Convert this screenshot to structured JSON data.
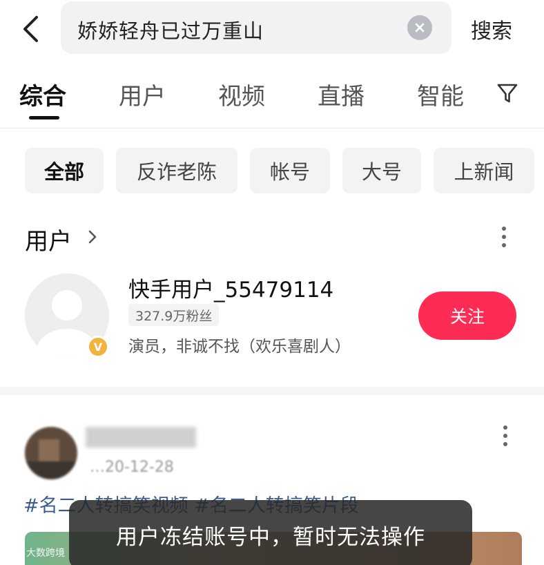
{
  "search": {
    "query": "娇娇轻舟已过万重山",
    "submit_label": "搜索",
    "back_icon": "chevron-left-icon",
    "clear_icon": "close-icon"
  },
  "tabs": [
    {
      "label": "综合",
      "active": true
    },
    {
      "label": "用户",
      "active": false
    },
    {
      "label": "视频",
      "active": false
    },
    {
      "label": "直播",
      "active": false
    },
    {
      "label": "智能",
      "active": false
    }
  ],
  "filter_icon": "filter-icon",
  "chips": [
    {
      "label": "全部",
      "active": true
    },
    {
      "label": "反诈老陈",
      "active": false
    },
    {
      "label": "帐号",
      "active": false
    },
    {
      "label": "大号",
      "active": false
    },
    {
      "label": "上新闻",
      "active": false
    }
  ],
  "user_section": {
    "title": "用户",
    "user": {
      "name": "快手用户_55479114",
      "fans": "327.9万粉丝",
      "description": "演员，非诚不找（欢乐喜剧人）",
      "badge": "V",
      "follow_label": "关注"
    }
  },
  "post": {
    "date": "…20-12-28",
    "tags": "#名二人转搞笑视频 #名二人转搞笑片段"
  },
  "toast": "用户冻结账号中，暂时无法操作",
  "watermark": "大数跨境",
  "colors": {
    "accent": "#fe2c55",
    "badge": "#f3b23c",
    "tag_text": "#3a5b8c"
  }
}
